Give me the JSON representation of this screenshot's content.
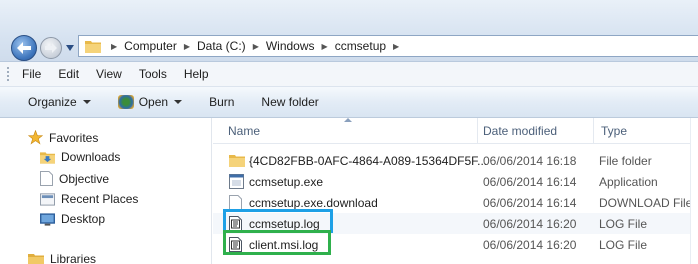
{
  "address": {
    "crumbs": [
      "Computer",
      "Data (C:)",
      "Windows",
      "ccmsetup"
    ]
  },
  "menu": [
    "File",
    "Edit",
    "View",
    "Tools",
    "Help"
  ],
  "commands": {
    "organize": "Organize",
    "open": "Open",
    "burn": "Burn",
    "new_folder": "New folder"
  },
  "nav": {
    "favorites": "Favorites",
    "downloads": "Downloads",
    "objective": "Objective",
    "recent_places": "Recent Places",
    "desktop": "Desktop",
    "libraries": "Libraries"
  },
  "columns": {
    "name": "Name",
    "date": "Date modified",
    "type": "Type"
  },
  "files": [
    {
      "name": "{4CD82FBB-0AFC-4864-A089-15364DF5F...",
      "date": "06/06/2014 16:18",
      "type": "File folder",
      "icon": "folder-icon"
    },
    {
      "name": "ccmsetup.exe",
      "date": "06/06/2014 16:14",
      "type": "Application",
      "icon": "application-icon"
    },
    {
      "name": "ccmsetup.exe.download",
      "date": "06/06/2014 16:14",
      "type": "DOWNLOAD File",
      "icon": "file-icon"
    },
    {
      "name": "ccmsetup.log",
      "date": "06/06/2014 16:20",
      "type": "LOG File",
      "icon": "log-file-icon"
    },
    {
      "name": "client.msi.log",
      "date": "06/06/2014 16:20",
      "type": "LOG File",
      "icon": "log-file-icon"
    }
  ],
  "colors": {
    "highlight_blue": "#1ea0e6",
    "highlight_green": "#2fb04c"
  }
}
